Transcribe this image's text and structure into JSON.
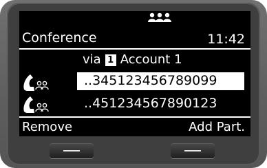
{
  "screen": {
    "title": "Conference",
    "time": "11:42",
    "via_prefix": "via",
    "account_badge": "1",
    "account_name": "Account 1",
    "participants": [
      {
        "number": "..345123456789099",
        "selected": true
      },
      {
        "number": "..451234567890123",
        "selected": false
      }
    ],
    "softkeys": {
      "left": "Remove",
      "right": "Add Part."
    }
  },
  "icons": {
    "status": "conference-group-icon",
    "participant": "handset-with-people-icon"
  },
  "colors": {
    "screen_bg": "#000000",
    "text": "#ffffff",
    "highlight": "#ffffff",
    "device": "#5e5e5e"
  }
}
